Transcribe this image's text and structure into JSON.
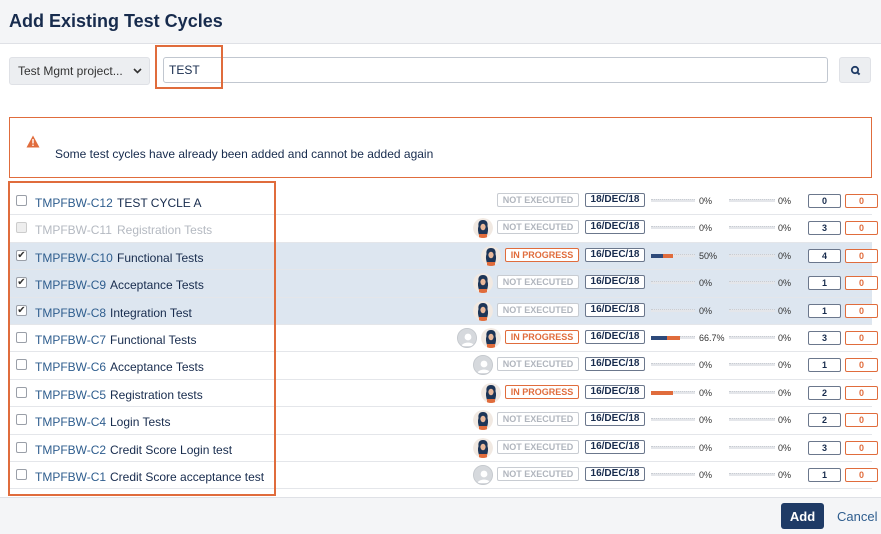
{
  "dialog": {
    "title": "Add Existing Test Cycles"
  },
  "filters": {
    "project_select": "Test Mgmt project...",
    "search_value": "TEST"
  },
  "warning": {
    "message": "Some test cycles have already been added and cannot be added again"
  },
  "rows": [
    {
      "key": "TMPFBW-C12",
      "name": "TEST CYCLE A",
      "checked": false,
      "disabled": false,
      "avatars": [],
      "status": "NOT EXECUTED",
      "status_type": "not-executed",
      "date": "18/DEC/18",
      "progress_pct": "0%",
      "progress_value": 0,
      "pct2": "0%",
      "count1": "0",
      "count2": "0"
    },
    {
      "key": "TMPFBW-C11",
      "name": "Registration Tests",
      "checked": false,
      "disabled": true,
      "avatars": [
        "user"
      ],
      "status": "NOT EXECUTED",
      "status_type": "not-executed",
      "date": "16/DEC/18",
      "progress_pct": "0%",
      "progress_value": 0,
      "pct2": "0%",
      "count1": "3",
      "count2": "0"
    },
    {
      "key": "TMPFBW-C10",
      "name": "Functional Tests",
      "checked": true,
      "disabled": false,
      "avatars": [
        "user"
      ],
      "status": "IN PROGRESS",
      "status_type": "in-progress",
      "date": "16/DEC/18",
      "progress_pct": "50%",
      "progress_value": 0.5,
      "pct2": "0%",
      "count1": "4",
      "count2": "0"
    },
    {
      "key": "TMPFBW-C9",
      "name": "Acceptance Tests",
      "checked": true,
      "disabled": false,
      "avatars": [
        "user"
      ],
      "status": "NOT EXECUTED",
      "status_type": "not-executed",
      "date": "16/DEC/18",
      "progress_pct": "0%",
      "progress_value": 0,
      "pct2": "0%",
      "count1": "1",
      "count2": "0"
    },
    {
      "key": "TMPFBW-C8",
      "name": "Integration Test",
      "checked": true,
      "disabled": false,
      "avatars": [
        "user"
      ],
      "status": "NOT EXECUTED",
      "status_type": "not-executed",
      "date": "16/DEC/18",
      "progress_pct": "0%",
      "progress_value": 0,
      "pct2": "0%",
      "count1": "1",
      "count2": "0"
    },
    {
      "key": "TMPFBW-C7",
      "name": "Functional Tests",
      "checked": false,
      "disabled": false,
      "avatars": [
        "gray",
        "user"
      ],
      "status": "IN PROGRESS",
      "status_type": "in-progress",
      "date": "16/DEC/18",
      "progress_pct": "66.7%",
      "progress_value": 0.667,
      "pct2": "0%",
      "count1": "3",
      "count2": "0"
    },
    {
      "key": "TMPFBW-C6",
      "name": "Acceptance Tests",
      "checked": false,
      "disabled": false,
      "avatars": [
        "gray"
      ],
      "status": "NOT EXECUTED",
      "status_type": "not-executed",
      "date": "16/DEC/18",
      "progress_pct": "0%",
      "progress_value": 0,
      "pct2": "0%",
      "count1": "1",
      "count2": "0"
    },
    {
      "key": "TMPFBW-C5",
      "name": "Registration tests",
      "checked": false,
      "disabled": false,
      "avatars": [
        "user"
      ],
      "status": "IN PROGRESS",
      "status_type": "in-progress",
      "date": "16/DEC/18",
      "progress_pct": "0%",
      "progress_value": 0.5,
      "pct2": "0%",
      "count1": "2",
      "count2": "0"
    },
    {
      "key": "TMPFBW-C4",
      "name": "Login Tests",
      "checked": false,
      "disabled": false,
      "avatars": [
        "user"
      ],
      "status": "NOT EXECUTED",
      "status_type": "not-executed",
      "date": "16/DEC/18",
      "progress_pct": "0%",
      "progress_value": 0,
      "pct2": "0%",
      "count1": "2",
      "count2": "0"
    },
    {
      "key": "TMPFBW-C2",
      "name": "Credit Score Login test",
      "checked": false,
      "disabled": false,
      "avatars": [
        "user"
      ],
      "status": "NOT EXECUTED",
      "status_type": "not-executed",
      "date": "16/DEC/18",
      "progress_pct": "0%",
      "progress_value": 0,
      "pct2": "0%",
      "count1": "3",
      "count2": "0"
    },
    {
      "key": "TMPFBW-C1",
      "name": "Credit Score acceptance test",
      "checked": false,
      "disabled": false,
      "avatars": [
        "gray"
      ],
      "status": "NOT EXECUTED",
      "status_type": "not-executed",
      "date": "16/DEC/18",
      "progress_pct": "0%",
      "progress_value": 0,
      "pct2": "0%",
      "count1": "1",
      "count2": "0"
    }
  ],
  "footer": {
    "add_label": "Add",
    "cancel_label": "Cancel"
  },
  "colors": {
    "accent": "#e06c3c",
    "primary": "#1f3b66",
    "link": "#2e5d8e",
    "selected_row": "#dde6f0",
    "bar_dark": "#2e4a7a"
  },
  "icons": {
    "search": "search-icon",
    "warning": "warning-icon",
    "chevron": "chevron-down-icon"
  }
}
